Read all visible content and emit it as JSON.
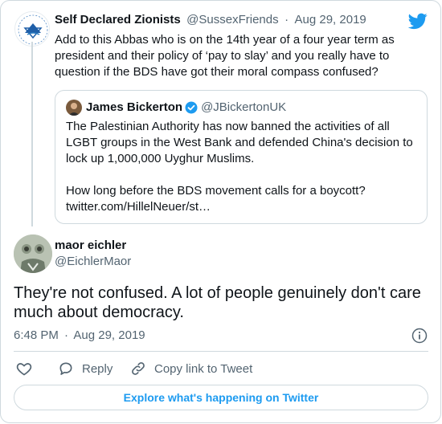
{
  "parent_tweet": {
    "display_name": "Self Declared Zionists",
    "handle": "@SussexFriends",
    "separator": "·",
    "date": "Aug 29, 2019",
    "text_lines": [
      "Add to this Abbas who is on the 14th year of a four year term as",
      "president and their policy of ‘pay to slay’ and you really have to",
      "question if the BDS have got their moral compass confused?"
    ]
  },
  "quoted_tweet": {
    "display_name": "James Bickerton",
    "handle": "@JBickertonUK",
    "text_lines": [
      "The Palestinian Authority has now banned the activities of all",
      "LGBT groups in the West Bank and defended China's decision to",
      "lock up 1,000,000 Uyghur Muslims."
    ],
    "text_lines_2": [
      "How long before the BDS movement calls for a boycott?",
      "twitter.com/HillelNeuer/st…"
    ]
  },
  "main_tweet": {
    "display_name": "maor eichler",
    "handle": "@EichlerMaor",
    "text_lines": [
      "They're not confused. A lot of people genuinely don't care",
      "much about democracy."
    ],
    "time": "6:48 PM",
    "separator": "·",
    "date": "Aug 29, 2019"
  },
  "actions": {
    "reply_label": "Reply",
    "copy_link_label": "Copy link to Tweet"
  },
  "footer": {
    "explore_label": "Explore what's happening on Twitter"
  },
  "colors": {
    "accent": "#1d9bf0",
    "verified": "#1d9bf0",
    "muted": "#536471",
    "border": "#cfd9de"
  },
  "icons": {
    "brand": "twitter-bird-icon",
    "verified": "verified-badge-icon",
    "info": "info-icon",
    "like": "heart-icon",
    "reply": "reply-icon",
    "copy": "link-icon"
  }
}
